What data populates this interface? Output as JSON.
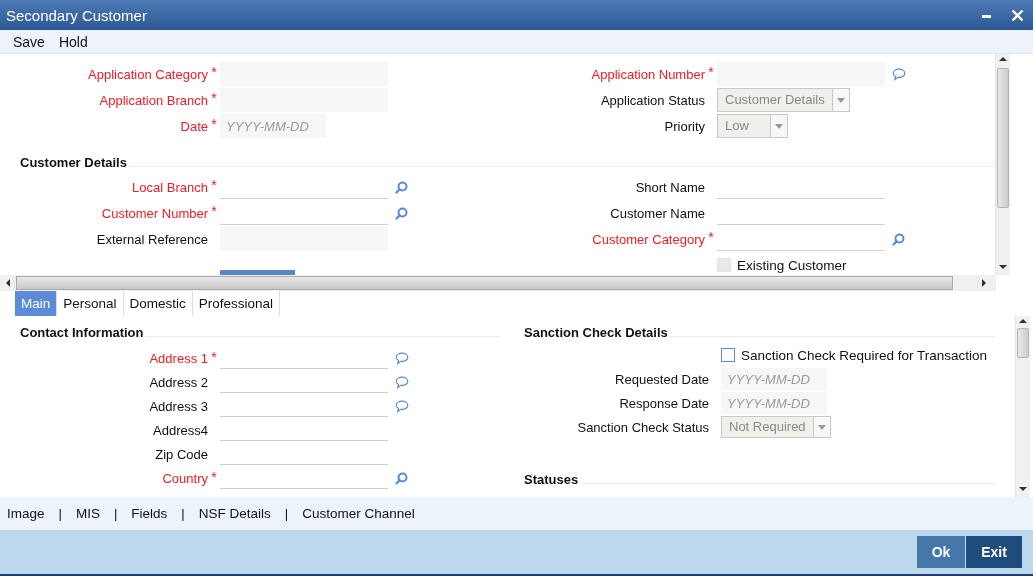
{
  "window": {
    "title": "Secondary Customer"
  },
  "toolbar": [
    "Save",
    "Hold"
  ],
  "required_mark": "*",
  "header": {
    "left": [
      {
        "label": "Application Category",
        "required": true,
        "kind": "shaded"
      },
      {
        "label": "Application Branch",
        "required": true,
        "kind": "shaded"
      },
      {
        "label": "Date",
        "required": true,
        "kind": "date",
        "placeholder": "YYYY-MM-DD"
      }
    ],
    "right": [
      {
        "label": "Application Number",
        "required": true,
        "kind": "shaded",
        "commentable": true
      },
      {
        "label": "Application Status",
        "required": false,
        "kind": "select",
        "value": "Customer Details"
      },
      {
        "label": "Priority",
        "required": false,
        "kind": "select",
        "value": "Low"
      }
    ]
  },
  "customer_details": {
    "title": "Customer Details",
    "left": [
      {
        "label": "Local Branch",
        "required": true,
        "kind": "line",
        "searchable": true
      },
      {
        "label": "Customer Number",
        "required": true,
        "kind": "line",
        "searchable": true
      },
      {
        "label": "External Reference",
        "required": false,
        "kind": "shaded"
      },
      {
        "kind": "cut-button"
      }
    ],
    "right": [
      {
        "label": "Short Name",
        "required": false,
        "kind": "line"
      },
      {
        "label": "Customer Name",
        "required": false,
        "kind": "line"
      },
      {
        "label": "Customer Category",
        "required": true,
        "kind": "line",
        "searchable": true
      },
      {
        "kind": "checkbox",
        "label": "Existing Customer",
        "checked": false,
        "disabled": true
      }
    ]
  },
  "tabs": [
    {
      "label": "Main",
      "selected": true
    },
    {
      "label": "Personal",
      "selected": false
    },
    {
      "label": "Domestic",
      "selected": false
    },
    {
      "label": "Professional",
      "selected": false
    }
  ],
  "contact": {
    "title": "Contact Information",
    "fields": [
      {
        "label": "Address 1",
        "required": true,
        "kind": "line",
        "commentable": true
      },
      {
        "label": "Address 2",
        "required": false,
        "kind": "line",
        "commentable": true
      },
      {
        "label": "Address 3",
        "required": false,
        "kind": "line",
        "commentable": true
      },
      {
        "label": "Address4",
        "required": false,
        "kind": "line"
      },
      {
        "label": "Zip Code",
        "required": false,
        "kind": "line"
      },
      {
        "label": "Country",
        "required": true,
        "kind": "line",
        "searchable": true
      }
    ]
  },
  "sanction": {
    "title": "Sanction Check Details",
    "fields": [
      {
        "kind": "checkbox",
        "label": "Sanction Check Required for Transaction",
        "checked": false,
        "disabled": false
      },
      {
        "label": "Requested Date",
        "required": false,
        "kind": "date",
        "placeholder": "YYYY-MM-DD"
      },
      {
        "label": "Response Date",
        "required": false,
        "kind": "date",
        "placeholder": "YYYY-MM-DD"
      },
      {
        "label": "Sanction Check Status",
        "required": false,
        "kind": "select",
        "value": "Not Required"
      }
    ]
  },
  "statuses": {
    "title": "Statuses"
  },
  "footer_links": [
    "Image",
    "MIS",
    "Fields",
    "NSF Details",
    "Customer Channel"
  ],
  "separator": "|",
  "buttons": [
    {
      "label": "Ok",
      "kind": "primary"
    },
    {
      "label": "Exit",
      "kind": "dark"
    }
  ]
}
